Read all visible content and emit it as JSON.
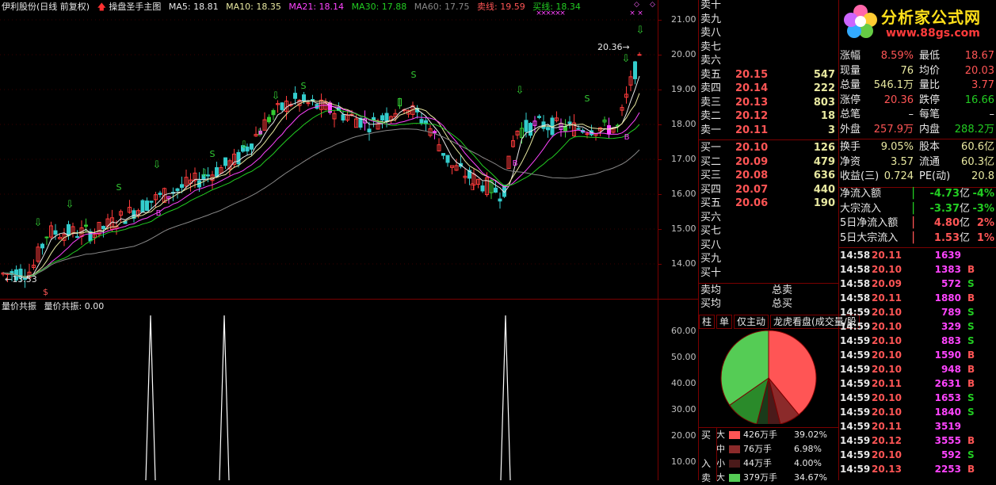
{
  "header": {
    "stock": "伊利股份(日线 前复权)",
    "indicator": "操盘圣手主图",
    "ma5": "MA5: 18.81",
    "ma10": "MA10: 18.35",
    "ma21": "MA21: 18.14",
    "ma30": "MA30: 17.88",
    "ma60": "MA60: 17.75",
    "sell_line": "卖线: 19.59",
    "buy_line": "买线: 18.34",
    "colors": {
      "ma5": "#e8e8e8",
      "ma10": "#e8e8a0",
      "ma21": "#ff44ff",
      "ma30": "#22cc22",
      "ma60": "#888888"
    }
  },
  "price_axis": [
    "21.00",
    "20.00",
    "19.00",
    "18.00",
    "17.00",
    "16.00",
    "15.00",
    "14.00"
  ],
  "annotations": {
    "low": "13.53",
    "high": "20.36",
    "marker_s": "S",
    "marker_b": "B",
    "marker_x": "×"
  },
  "sub_indicator": {
    "title": "量价共振",
    "label": "量价共振: 0.00"
  },
  "volume_axis": [
    "60.00",
    "50.00",
    "40.00",
    "30.00",
    "20.00",
    "10.00"
  ],
  "order_book": {
    "sell": [
      {
        "label": "卖十",
        "price": "",
        "vol": ""
      },
      {
        "label": "卖九",
        "price": "",
        "vol": ""
      },
      {
        "label": "卖八",
        "price": "",
        "vol": ""
      },
      {
        "label": "卖七",
        "price": "",
        "vol": ""
      },
      {
        "label": "卖六",
        "price": "",
        "vol": ""
      },
      {
        "label": "卖五",
        "price": "20.15",
        "vol": "547"
      },
      {
        "label": "卖四",
        "price": "20.14",
        "vol": "222"
      },
      {
        "label": "卖三",
        "price": "20.13",
        "vol": "803"
      },
      {
        "label": "卖二",
        "price": "20.12",
        "vol": "18"
      },
      {
        "label": "卖一",
        "price": "20.11",
        "vol": "3"
      }
    ],
    "buy": [
      {
        "label": "买一",
        "price": "20.10",
        "vol": "126"
      },
      {
        "label": "买二",
        "price": "20.09",
        "vol": "479"
      },
      {
        "label": "买三",
        "price": "20.08",
        "vol": "636"
      },
      {
        "label": "买四",
        "price": "20.07",
        "vol": "440"
      },
      {
        "label": "买五",
        "price": "20.06",
        "vol": "190"
      },
      {
        "label": "买六",
        "price": "",
        "vol": ""
      },
      {
        "label": "买七",
        "price": "",
        "vol": ""
      },
      {
        "label": "买八",
        "price": "",
        "vol": ""
      },
      {
        "label": "买九",
        "price": "",
        "vol": ""
      },
      {
        "label": "买十",
        "price": "",
        "vol": ""
      }
    ],
    "avg_sell": "卖均",
    "total_sell": "总卖",
    "avg_buy": "买均",
    "total_buy": "总买"
  },
  "pie_panel": {
    "tabs": [
      "柱",
      "单",
      "仅主动",
      "龙虎看盘(成交量/股"
    ],
    "chart_data": {
      "type": "pie",
      "slices": [
        {
          "name": "大",
          "value": 39.02,
          "color": "#ff5555"
        },
        {
          "name": "中",
          "value": 6.98,
          "color": "#8b2a2a"
        },
        {
          "name": "小",
          "value": 4.0,
          "color": "#4a1a1a"
        },
        {
          "name": "小(卖)",
          "value": 4.0,
          "color": "#1a3a1a"
        },
        {
          "name": "中(卖)",
          "value": 11.3,
          "color": "#2a8a2a"
        },
        {
          "name": "大(卖)",
          "value": 34.67,
          "color": "#55cc55"
        }
      ]
    },
    "legend": [
      {
        "side": "买",
        "size": "大",
        "vol": "426万手",
        "pct": "39.02%",
        "color": "#ff5555"
      },
      {
        "side": "",
        "size": "中",
        "vol": "76万手",
        "pct": "6.98%",
        "color": "#8b2a2a"
      },
      {
        "side": "入",
        "size": "小",
        "vol": "44万手",
        "pct": "4.00%",
        "color": "#4a1a1a"
      },
      {
        "side": "卖",
        "size": "大",
        "vol": "379万手",
        "pct": "34.67%",
        "color": "#55cc55"
      }
    ]
  },
  "logo": {
    "title": "分析家公式网",
    "url": "www.88gs.com"
  },
  "quote": [
    {
      "l1": "涨幅",
      "v1": "8.59%",
      "c1": "red",
      "l2": "最低",
      "v2": "18.67",
      "c2": "red"
    },
    {
      "l1": "现量",
      "v1": "76",
      "c1": "yellow",
      "l2": "均价",
      "v2": "20.03",
      "c2": "red"
    },
    {
      "l1": "总量",
      "v1": "546.1万",
      "c1": "yellow",
      "l2": "量比",
      "v2": "3.77",
      "c2": "red"
    },
    {
      "l1": "涨停",
      "v1": "20.36",
      "c1": "red",
      "l2": "跌停",
      "v2": "16.66",
      "c2": "green"
    },
    {
      "l1": "总笔",
      "v1": "–",
      "c1": "white",
      "l2": "每笔",
      "v2": "–",
      "c2": "white"
    },
    {
      "l1": "外盘",
      "v1": "257.9万",
      "c1": "red",
      "l2": "内盘",
      "v2": "288.2万",
      "c2": "green"
    },
    {
      "l1": "换手",
      "v1": "9.05%",
      "c1": "yellow",
      "l2": "股本",
      "v2": "60.6亿",
      "c2": "yellow"
    },
    {
      "l1": "净资",
      "v1": "3.57",
      "c1": "yellow",
      "l2": "流通",
      "v2": "60.3亿",
      "c2": "yellow"
    },
    {
      "l1": "收益(三)",
      "v1": "0.724",
      "c1": "yellow",
      "l2": "PE(动)",
      "v2": "20.8",
      "c2": "yellow"
    }
  ],
  "flows": [
    {
      "label": "净流入额",
      "val": "-4.73",
      "pct": "-4%",
      "color": "green"
    },
    {
      "label": "大宗流入",
      "val": "-3.37",
      "pct": "-3%",
      "color": "green"
    },
    {
      "label": "5日净流入额",
      "val": "4.80",
      "pct": "2%",
      "color": "red"
    },
    {
      "label": "5日大宗流入",
      "val": "1.53",
      "pct": "1%",
      "color": "red"
    }
  ],
  "flow_unit": "亿",
  "trades": [
    {
      "t": "14:58",
      "p": "20.11",
      "v": "1639",
      "s": ""
    },
    {
      "t": "14:58",
      "p": "20.10",
      "v": "1383",
      "s": "B"
    },
    {
      "t": "14:58",
      "p": "20.09",
      "v": "572",
      "s": "S"
    },
    {
      "t": "14:58",
      "p": "20.11",
      "v": "1880",
      "s": "B"
    },
    {
      "t": "14:59",
      "p": "20.10",
      "v": "789",
      "s": "S"
    },
    {
      "t": "14:59",
      "p": "20.10",
      "v": "329",
      "s": "S"
    },
    {
      "t": "14:59",
      "p": "20.10",
      "v": "883",
      "s": "S"
    },
    {
      "t": "14:59",
      "p": "20.10",
      "v": "1590",
      "s": "B"
    },
    {
      "t": "14:59",
      "p": "20.10",
      "v": "948",
      "s": "B"
    },
    {
      "t": "14:59",
      "p": "20.11",
      "v": "2631",
      "s": "B"
    },
    {
      "t": "14:59",
      "p": "20.10",
      "v": "1653",
      "s": "S"
    },
    {
      "t": "14:59",
      "p": "20.10",
      "v": "1840",
      "s": "S"
    },
    {
      "t": "14:59",
      "p": "20.11",
      "v": "3519",
      "s": ""
    },
    {
      "t": "14:59",
      "p": "20.12",
      "v": "3555",
      "s": "B"
    },
    {
      "t": "14:59",
      "p": "20.10",
      "v": "592",
      "s": "S"
    },
    {
      "t": "14:59",
      "p": "20.13",
      "v": "2253",
      "s": "B"
    }
  ]
}
